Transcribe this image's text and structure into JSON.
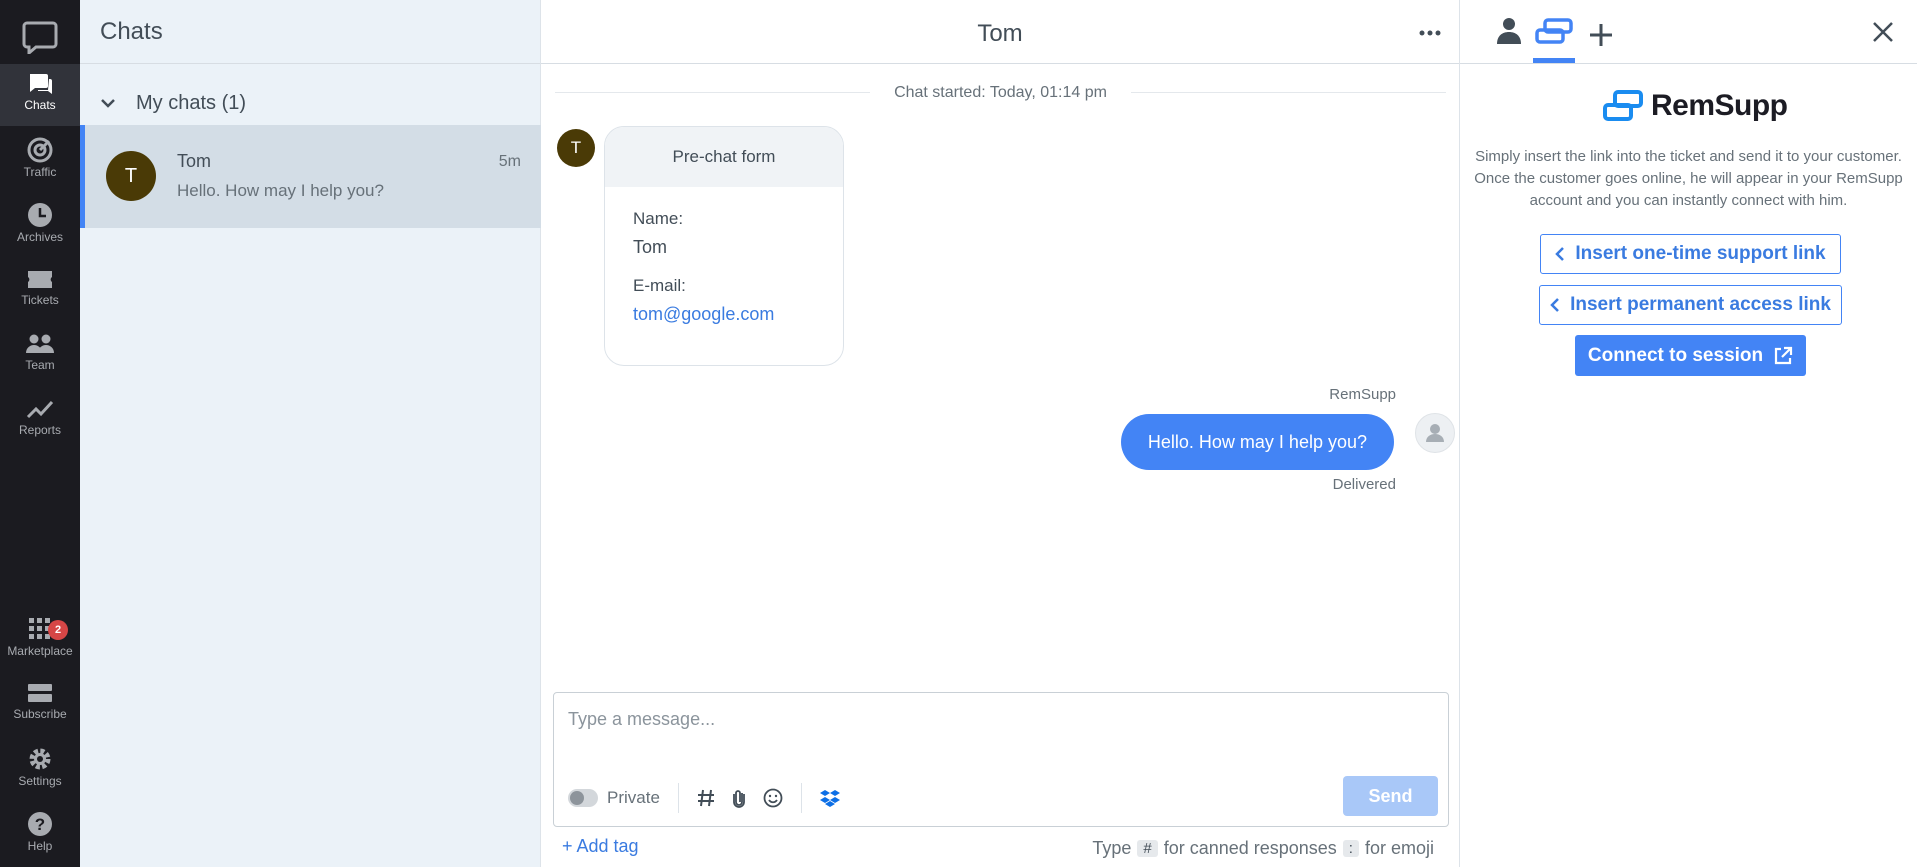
{
  "nav": {
    "items": [
      {
        "label": "Chats",
        "icon": "chat-bubble-icon"
      },
      {
        "label": "Traffic",
        "icon": "traffic-icon"
      },
      {
        "label": "Archives",
        "icon": "clock-icon"
      },
      {
        "label": "Tickets",
        "icon": "ticket-icon"
      },
      {
        "label": "Team",
        "icon": "team-icon"
      },
      {
        "label": "Reports",
        "icon": "chart-line-icon"
      }
    ],
    "bottom": [
      {
        "label": "Marketplace",
        "icon": "grid-icon",
        "badge": "2"
      },
      {
        "label": "Subscribe",
        "icon": "card-icon"
      },
      {
        "label": "Settings",
        "icon": "gear-icon"
      },
      {
        "label": "Help",
        "icon": "help-icon"
      }
    ]
  },
  "list": {
    "title": "Chats",
    "section": "My chats (1)",
    "chat": {
      "initial": "T",
      "name": "Tom",
      "time": "5m",
      "preview": "Hello. How may I help you?"
    }
  },
  "conversation": {
    "title": "Tom",
    "started": "Chat started: Today, 01:14 pm",
    "customer_initial": "T",
    "form": {
      "title": "Pre-chat form",
      "name_label": "Name:",
      "name_value": "Tom",
      "email_label": "E-mail:",
      "email_value": "tom@google.com"
    },
    "agent_name": "RemSupp",
    "message": "Hello. How may I help you?",
    "status": "Delivered"
  },
  "composer": {
    "placeholder": "Type a message...",
    "private_label": "Private",
    "send_label": "Send",
    "add_tag": "+ Add tag",
    "hint_type": "Type",
    "hint_hash": "#",
    "hint_canned": "for canned responses",
    "hint_colon": ":",
    "hint_emoji": "for emoji"
  },
  "panel": {
    "logo_text": "RemSupp",
    "description": "Simply insert the link into the ticket and send it to your customer. Once the customer goes online, he will appear in your RemSupp account and you can instantly connect with him.",
    "btn_one_time": "Insert one-time support link",
    "btn_permanent": "Insert permanent access link",
    "btn_connect": "Connect to session"
  },
  "colors": {
    "accent": "#4384f5",
    "nav_bg": "#1b1b20",
    "list_bg": "#ebf2f8"
  }
}
